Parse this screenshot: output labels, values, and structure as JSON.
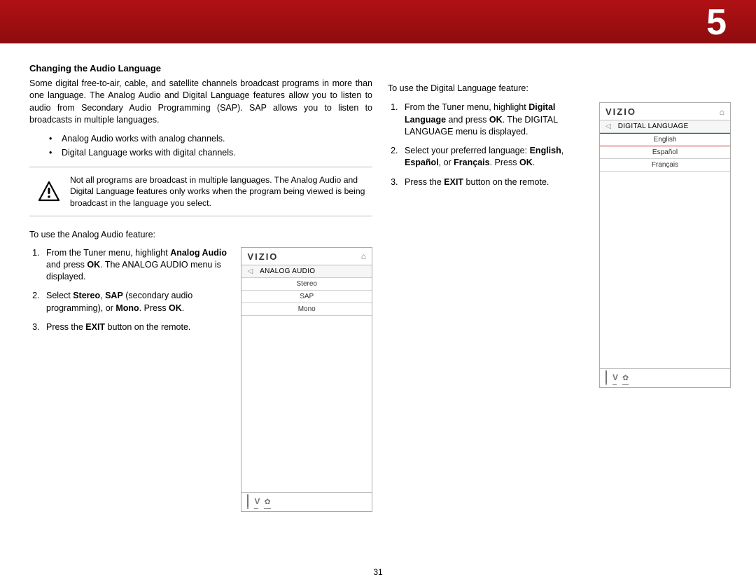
{
  "chapter_number": "5",
  "page_number": "31",
  "left": {
    "heading": "Changing the Audio Language",
    "intro": "Some digital free-to-air, cable, and satellite channels broadcast programs in more than one language. The Analog Audio and Digital Language features allow you to listen to audio from Secondary Audio Programming (SAP). SAP allows you to listen to broadcasts in multiple languages.",
    "bullets": [
      "Analog Audio works with analog channels.",
      "Digital Language works with digital channels."
    ],
    "note": "Not all programs are broadcast in multiple languages. The Analog Audio and Digital Language features only works when the program being viewed is being broadcast in the language you select.",
    "use_intro": "To use the Analog Audio feature:",
    "steps": [
      {
        "pre": "From the Tuner menu, highlight ",
        "b1": "Analog Audio",
        "mid1": " and press ",
        "b2": "OK",
        "post": ". The ANALOG AUDIO menu is displayed."
      },
      {
        "pre": "Select ",
        "b1": "Stereo",
        "mid1": ", ",
        "b2": "SAP",
        "mid2": " (secondary audio programming), or ",
        "b3": "Mono",
        "post": ". Press ",
        "b4": "OK",
        "post2": "."
      },
      {
        "pre": "Press the ",
        "b1": "EXIT",
        "post": " button on the remote."
      }
    ]
  },
  "right": {
    "use_intro": "To use the Digital Language feature:",
    "steps": [
      {
        "pre": "From the Tuner menu, highlight ",
        "b1": "Digital Language",
        "mid1": " and press ",
        "b2": "OK",
        "post": ". The DIGITAL LANGUAGE menu is displayed."
      },
      {
        "pre": "Select your preferred language: ",
        "b1": "English",
        "mid1": ", ",
        "b2": "Español",
        "mid2": ", or ",
        "b3": "Français",
        "post": ". Press ",
        "b4": "OK",
        "post2": "."
      },
      {
        "pre": "Press the ",
        "b1": "EXIT",
        "post": " button on the remote."
      }
    ]
  },
  "phone_analog": {
    "brand": "VIZIO",
    "title": "ANALOG AUDIO",
    "options": [
      "Stereo",
      "SAP",
      "Mono"
    ]
  },
  "phone_digital": {
    "brand": "VIZIO",
    "title": "DIGITAL LANGUAGE",
    "options": [
      "English",
      "Español",
      "Français"
    ]
  }
}
